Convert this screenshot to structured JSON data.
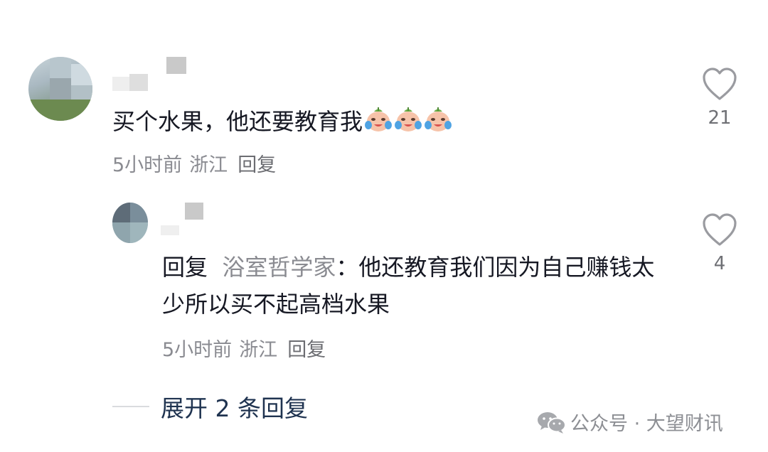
{
  "comment": {
    "text": "买个水果，他还要教育我",
    "emoji": [
      "crying-laughing-emoji",
      "crying-laughing-emoji",
      "crying-laughing-emoji"
    ],
    "time": "5小时前",
    "location": "浙江",
    "reply_label": "回复",
    "likes": "21"
  },
  "reply": {
    "prefix": "回复",
    "to_name": "浴室哲学家",
    "colon": "：",
    "text": "他还教育我们因为自己赚钱太少所以买不起高档水果",
    "time": "5小时前",
    "location": "浙江",
    "reply_label": "回复",
    "likes": "4"
  },
  "expand_label": "展开 2 条回复",
  "watermark": {
    "icon": "wechat-icon",
    "text": "公众号 · 大望财讯"
  },
  "colors": {
    "text": "#161823",
    "meta": "#8a8b91",
    "expand": "#1f3350",
    "heart": "#9a9ba0"
  }
}
